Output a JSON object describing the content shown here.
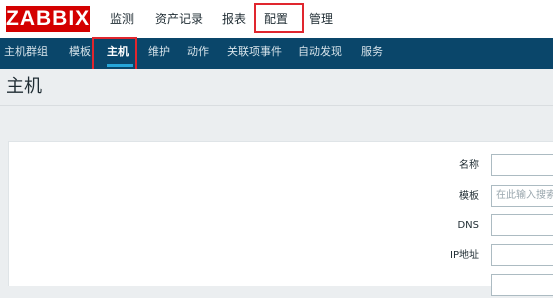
{
  "brand": {
    "logo": "ZABBIX",
    "accent": "#d40000"
  },
  "main_menu": {
    "items": [
      "监测",
      "资产记录",
      "报表",
      "配置",
      "管理"
    ],
    "active": "配置"
  },
  "sub_nav": {
    "items": [
      "主机群组",
      "模板",
      "主机",
      "维护",
      "动作",
      "关联项事件",
      "自动发现",
      "服务"
    ],
    "active": "主机"
  },
  "page": {
    "title": "主机"
  },
  "filter": {
    "fields": [
      {
        "label": "名称",
        "value": "",
        "placeholder": ""
      },
      {
        "label": "模板",
        "value": "",
        "placeholder": "在此输入搜索"
      },
      {
        "label": "DNS",
        "value": "",
        "placeholder": ""
      },
      {
        "label": "IP地址",
        "value": "",
        "placeholder": ""
      }
    ]
  },
  "colors": {
    "subnav_bg": "#0a466a",
    "highlight": "#e0262e",
    "active_underline": "#26a6d9"
  }
}
